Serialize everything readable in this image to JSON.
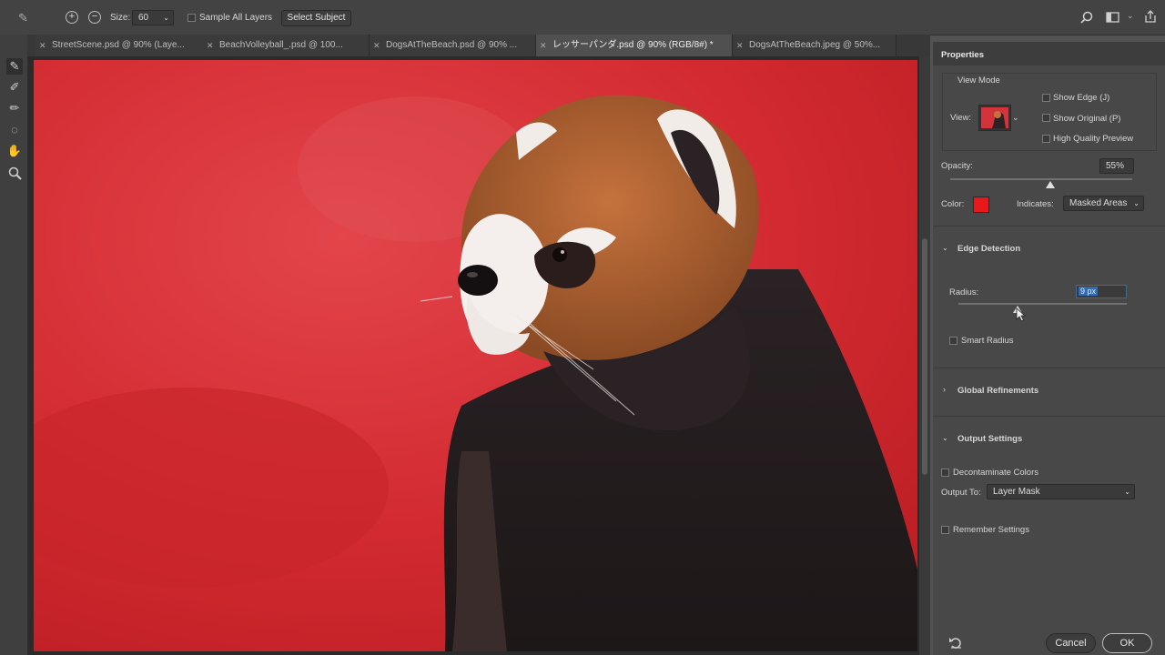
{
  "options_bar": {
    "size_label": "Size:",
    "size_value": "60",
    "sample_all_layers": "Sample All Layers",
    "select_subject": "Select Subject"
  },
  "tabs": [
    {
      "label": "StreetScene.psd @ 90% (Laye..."
    },
    {
      "label": "BeachVolleyball_.psd @ 100..."
    },
    {
      "label": "DogsAtTheBeach.psd @ 90% ..."
    },
    {
      "label": "レッサーパンダ.psd @ 90% (RGB/8#) *"
    },
    {
      "label": "DogsAtTheBeach.jpeg @ 50%..."
    }
  ],
  "properties": {
    "title": "Properties",
    "view_mode": {
      "heading": "View Mode",
      "view_label": "View:",
      "show_edge": "Show Edge (J)",
      "show_original": "Show Original (P)",
      "high_quality_preview": "High Quality Preview"
    },
    "opacity": {
      "label": "Opacity:",
      "value": "55%",
      "level": 0.55
    },
    "color": {
      "label": "Color:",
      "swatch": "#e8191c"
    },
    "indicates": {
      "label": "Indicates:",
      "value": "Masked Areas"
    },
    "edge_detection": {
      "heading": "Edge Detection",
      "radius_label": "Radius:",
      "radius_value": "9 px",
      "radius_level": 0.35,
      "smart_radius": "Smart Radius"
    },
    "global_refinements": {
      "heading": "Global Refinements"
    },
    "output_settings": {
      "heading": "Output Settings",
      "decontaminate": "Decontaminate Colors",
      "output_to_label": "Output To:",
      "output_to_value": "Layer Mask",
      "remember": "Remember Settings"
    },
    "cancel": "Cancel",
    "ok": "OK"
  },
  "colors": {
    "overlay_red": "#d52a2f",
    "panel": "#484848",
    "accent": "#2f6db8"
  },
  "icons": [
    "brush-icon",
    "refine-edge-brush-icon",
    "quick-selection-icon",
    "lasso-icon",
    "hand-icon",
    "zoom-icon",
    "search-icon",
    "workspace-icon",
    "share-icon",
    "reset-icon"
  ]
}
